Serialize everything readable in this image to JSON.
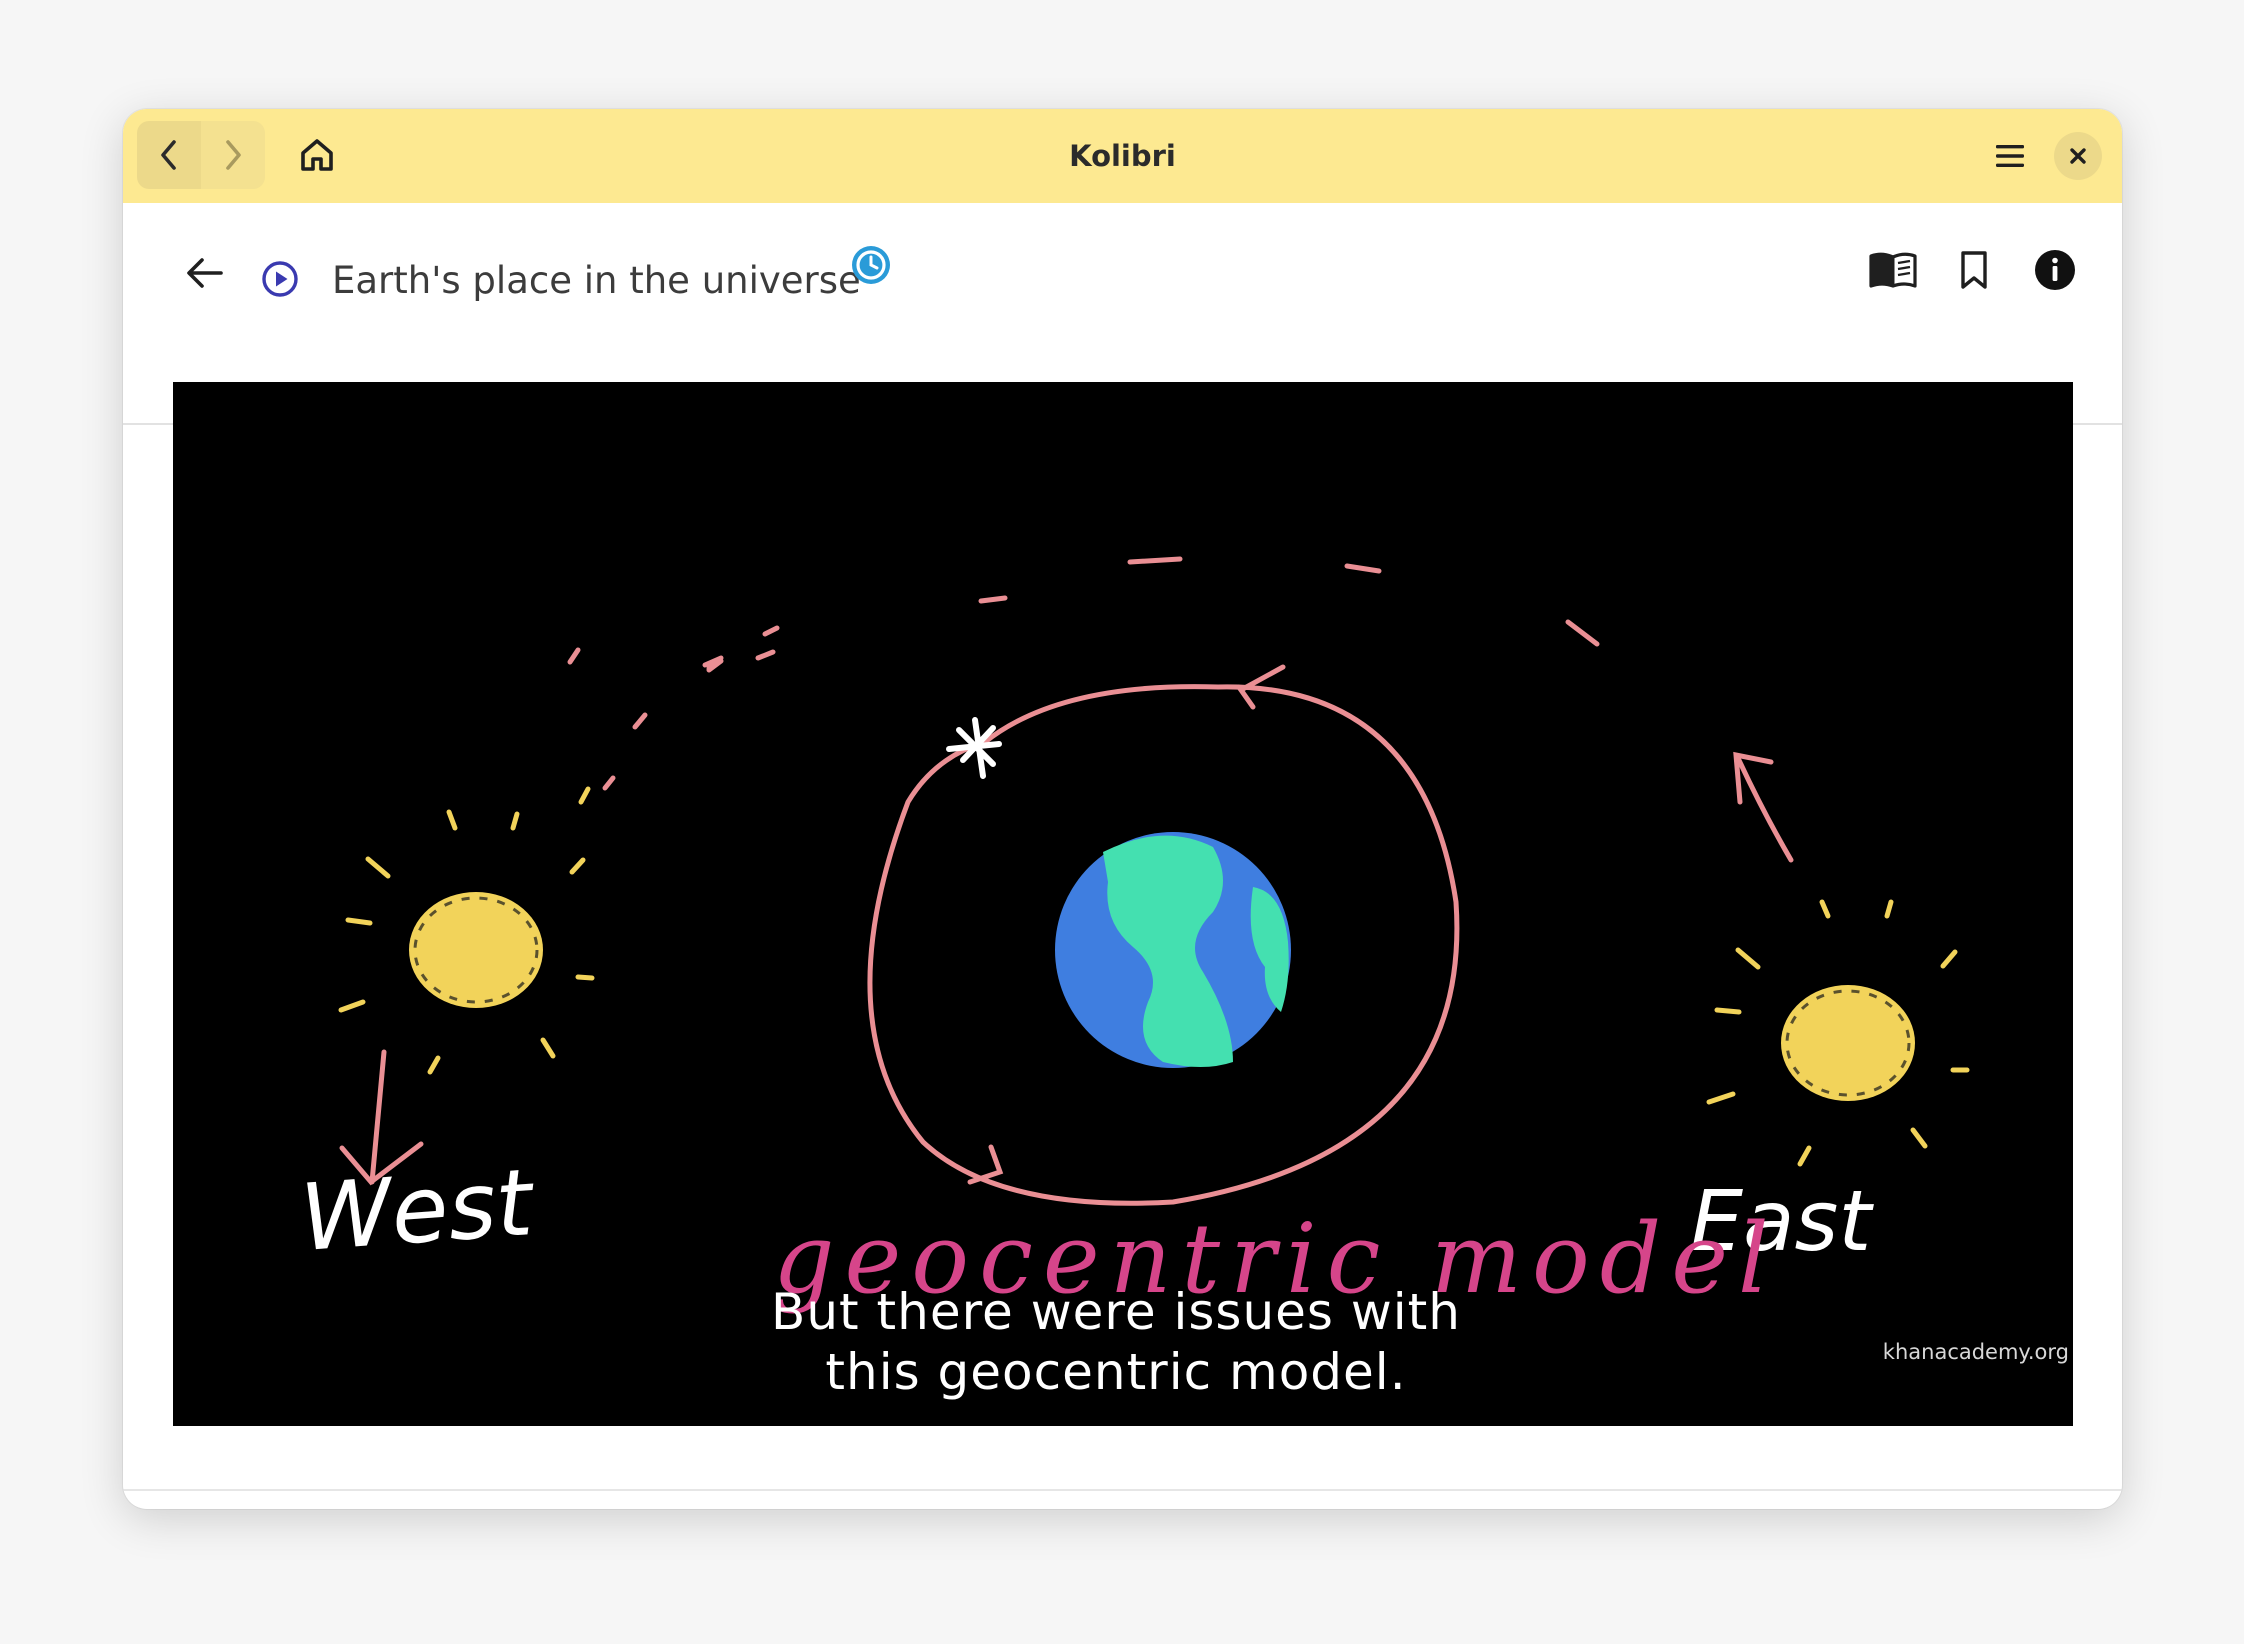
{
  "window": {
    "title": "Kolibri"
  },
  "titlebar": {
    "back_icon": "chevron-left-icon",
    "forward_icon": "chevron-right-icon",
    "home_icon": "home-icon",
    "menu_icon": "hamburger-menu-icon",
    "close_icon": "close-icon"
  },
  "toolbar": {
    "back_icon": "arrow-left-icon",
    "content_kind_icon": "video-play-icon",
    "content_title": "Earth's place in the universe",
    "progress_icon": "in-progress-clock-icon",
    "actions": [
      {
        "name": "view-resource-list-button",
        "icon": "open-book-icon"
      },
      {
        "name": "bookmark-button",
        "icon": "bookmark-icon"
      },
      {
        "name": "info-button",
        "icon": "info-icon"
      }
    ]
  },
  "video": {
    "drawn_labels": {
      "left": "West",
      "right": "East",
      "bottom": "geocentric model"
    },
    "caption_line1": "But there were issues with",
    "caption_line2": "this geocentric model.",
    "watermark": "khanacademy.org"
  },
  "colors": {
    "titlebar_bg": "#fde991",
    "accent_blue": "#2a9bd8",
    "kind_icon": "#3a3ab0",
    "orbit_pink": "#ea8f94",
    "sun_yellow": "#f2d35a",
    "earth_blue": "#3f7ee0",
    "earth_green": "#44e0b0",
    "label_magenta": "#d6458a"
  }
}
